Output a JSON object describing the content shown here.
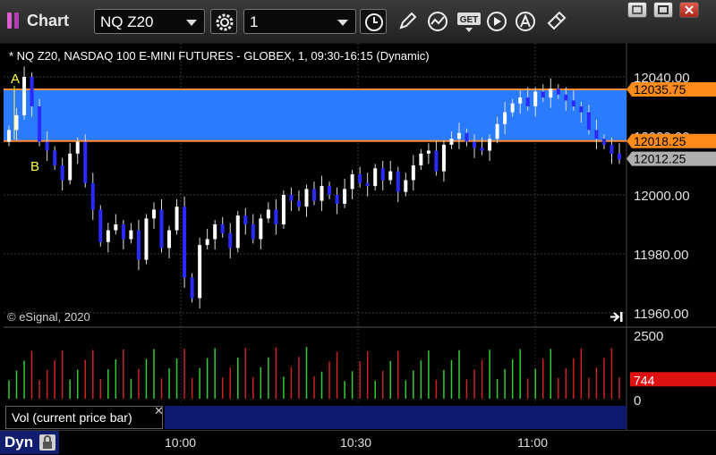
{
  "window": {
    "title": "Chart"
  },
  "toolbar": {
    "symbol": "NQ Z20",
    "interval": "1",
    "icons": [
      "settings-gear-icon",
      "clock-icon",
      "pencil-icon",
      "study-icon",
      "get-icon",
      "play-icon",
      "alert-icon",
      "cursor-icon"
    ]
  },
  "chart": {
    "title": "* NQ Z20, NASDAQ 100 E-MINI FUTURES - GLOBEX, 1, 09:30-16:15 (Dynamic)",
    "copyright": "© eSignal, 2020",
    "price_axis": [
      "12040.00",
      "12020.00",
      "12000.00",
      "11980.00",
      "11960.00"
    ],
    "time_axis": [
      "10:00",
      "10:30",
      "11:00"
    ],
    "markers": {
      "a": "A",
      "b": "B"
    },
    "price_tags": {
      "upper": "12035.75",
      "lower": "12018.25",
      "last": "12012.25"
    },
    "colors": {
      "up": "#ffffff",
      "down": "#2a2aff",
      "band": "#2b7bff",
      "band_edge": "#ff8c33",
      "last_tag": "#b0b0b0"
    }
  },
  "volume": {
    "label": "Vol (current price bar)",
    "axis": [
      "2500",
      "0"
    ],
    "current": "744",
    "current_color": "#dd1111"
  },
  "bottom": {
    "mode": "Dyn"
  },
  "chart_data": {
    "type": "candlestick",
    "title": "* NQ Z20, NASDAQ 100 E-MINI FUTURES - GLOBEX, 1, 09:30-16:15 (Dynamic)",
    "ylim": [
      11960,
      12045
    ],
    "x_ticks": [
      "10:00",
      "10:30",
      "11:00"
    ],
    "y_ticks": [
      12040,
      12020,
      12000,
      11980,
      11960
    ],
    "series": [
      {
        "name": "price",
        "closes": [
          12022,
          12027,
          12040,
          12030,
          12018,
          12015,
          12010,
          12005,
          12014,
          12018,
          12004,
          11995,
          11984,
          11988,
          11990,
          11985,
          11988,
          11978,
          11992,
          11995,
          11982,
          11988,
          11996,
          11972,
          11965,
          11983,
          11985,
          11990,
          11987,
          11982,
          11993,
          11990,
          11985,
          11992,
          11995,
          11990,
          12000,
          11998,
          11996,
          12002,
          11998,
          12003,
          12000,
          11997,
          12002,
          12007,
          12004,
          12003,
          12009,
          12005,
          12008,
          12001,
          12005,
          12010,
          12014,
          12015,
          12008,
          12017,
          12019,
          12021,
          12018,
          12016,
          12015,
          12019,
          12024,
          12028,
          12031,
          12033,
          12030,
          12035,
          12033,
          12036,
          12034,
          12032,
          12030,
          12028,
          12022,
          12019,
          12017,
          12014,
          12012
        ]
      }
    ],
    "volume": {
      "axis_max": 2500,
      "current": 744
    }
  }
}
